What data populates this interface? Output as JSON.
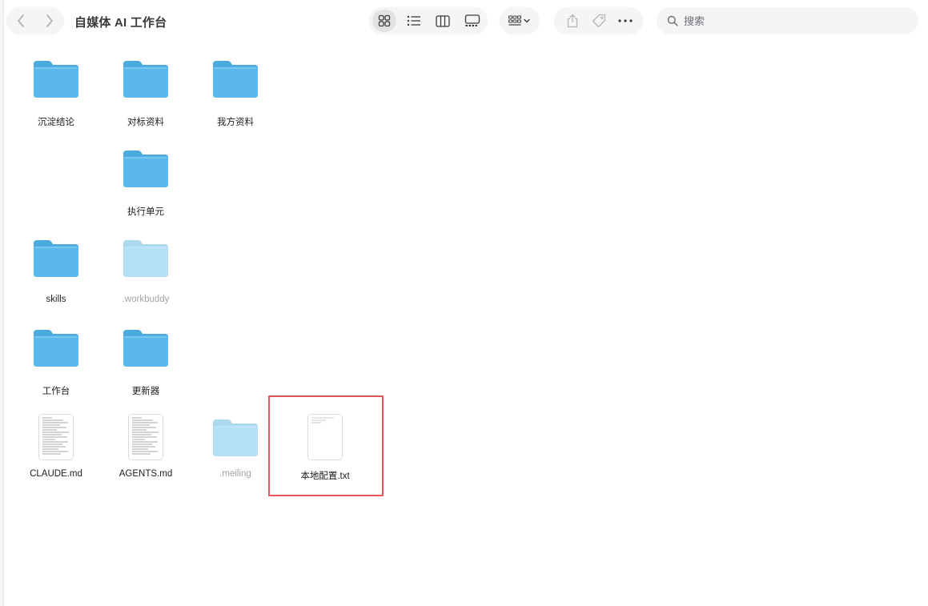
{
  "window": {
    "title": "自媒体 AI 工作台"
  },
  "toolbar": {
    "back_icon": "chevron-left-icon",
    "forward_icon": "chevron-right-icon",
    "view_modes": [
      "icon-view-icon",
      "list-view-icon",
      "column-view-icon",
      "gallery-view-icon"
    ],
    "active_view": "icon-view-icon",
    "group_icon": "group-by-icon",
    "share_icon": "share-icon",
    "tag_icon": "tag-icon",
    "more_icon": "more-icon"
  },
  "search": {
    "placeholder": "搜索",
    "value": ""
  },
  "items": [
    {
      "name": "沉淀结论",
      "kind": "folder",
      "hidden": false
    },
    {
      "name": "对标资料",
      "kind": "folder",
      "hidden": false
    },
    {
      "name": "我方资料",
      "kind": "folder",
      "hidden": false
    },
    {
      "name": "执行单元",
      "kind": "folder",
      "hidden": false
    },
    {
      "name": "skills",
      "kind": "folder",
      "hidden": false
    },
    {
      "name": ".workbuddy",
      "kind": "folder",
      "hidden": true
    },
    {
      "name": "工作台",
      "kind": "folder",
      "hidden": false
    },
    {
      "name": "更新器",
      "kind": "folder",
      "hidden": false
    },
    {
      "name": "CLAUDE.md",
      "kind": "markdown",
      "hidden": false
    },
    {
      "name": "AGENTS.md",
      "kind": "markdown",
      "hidden": false
    },
    {
      "name": ".meiling",
      "kind": "folder",
      "hidden": true
    },
    {
      "name": "本地配置.txt",
      "kind": "text",
      "hidden": false,
      "highlighted": true
    }
  ],
  "colors": {
    "folder_body": "#5ab9ea",
    "folder_tab": "#4aa9dd",
    "highlight_border": "#e5565b"
  }
}
